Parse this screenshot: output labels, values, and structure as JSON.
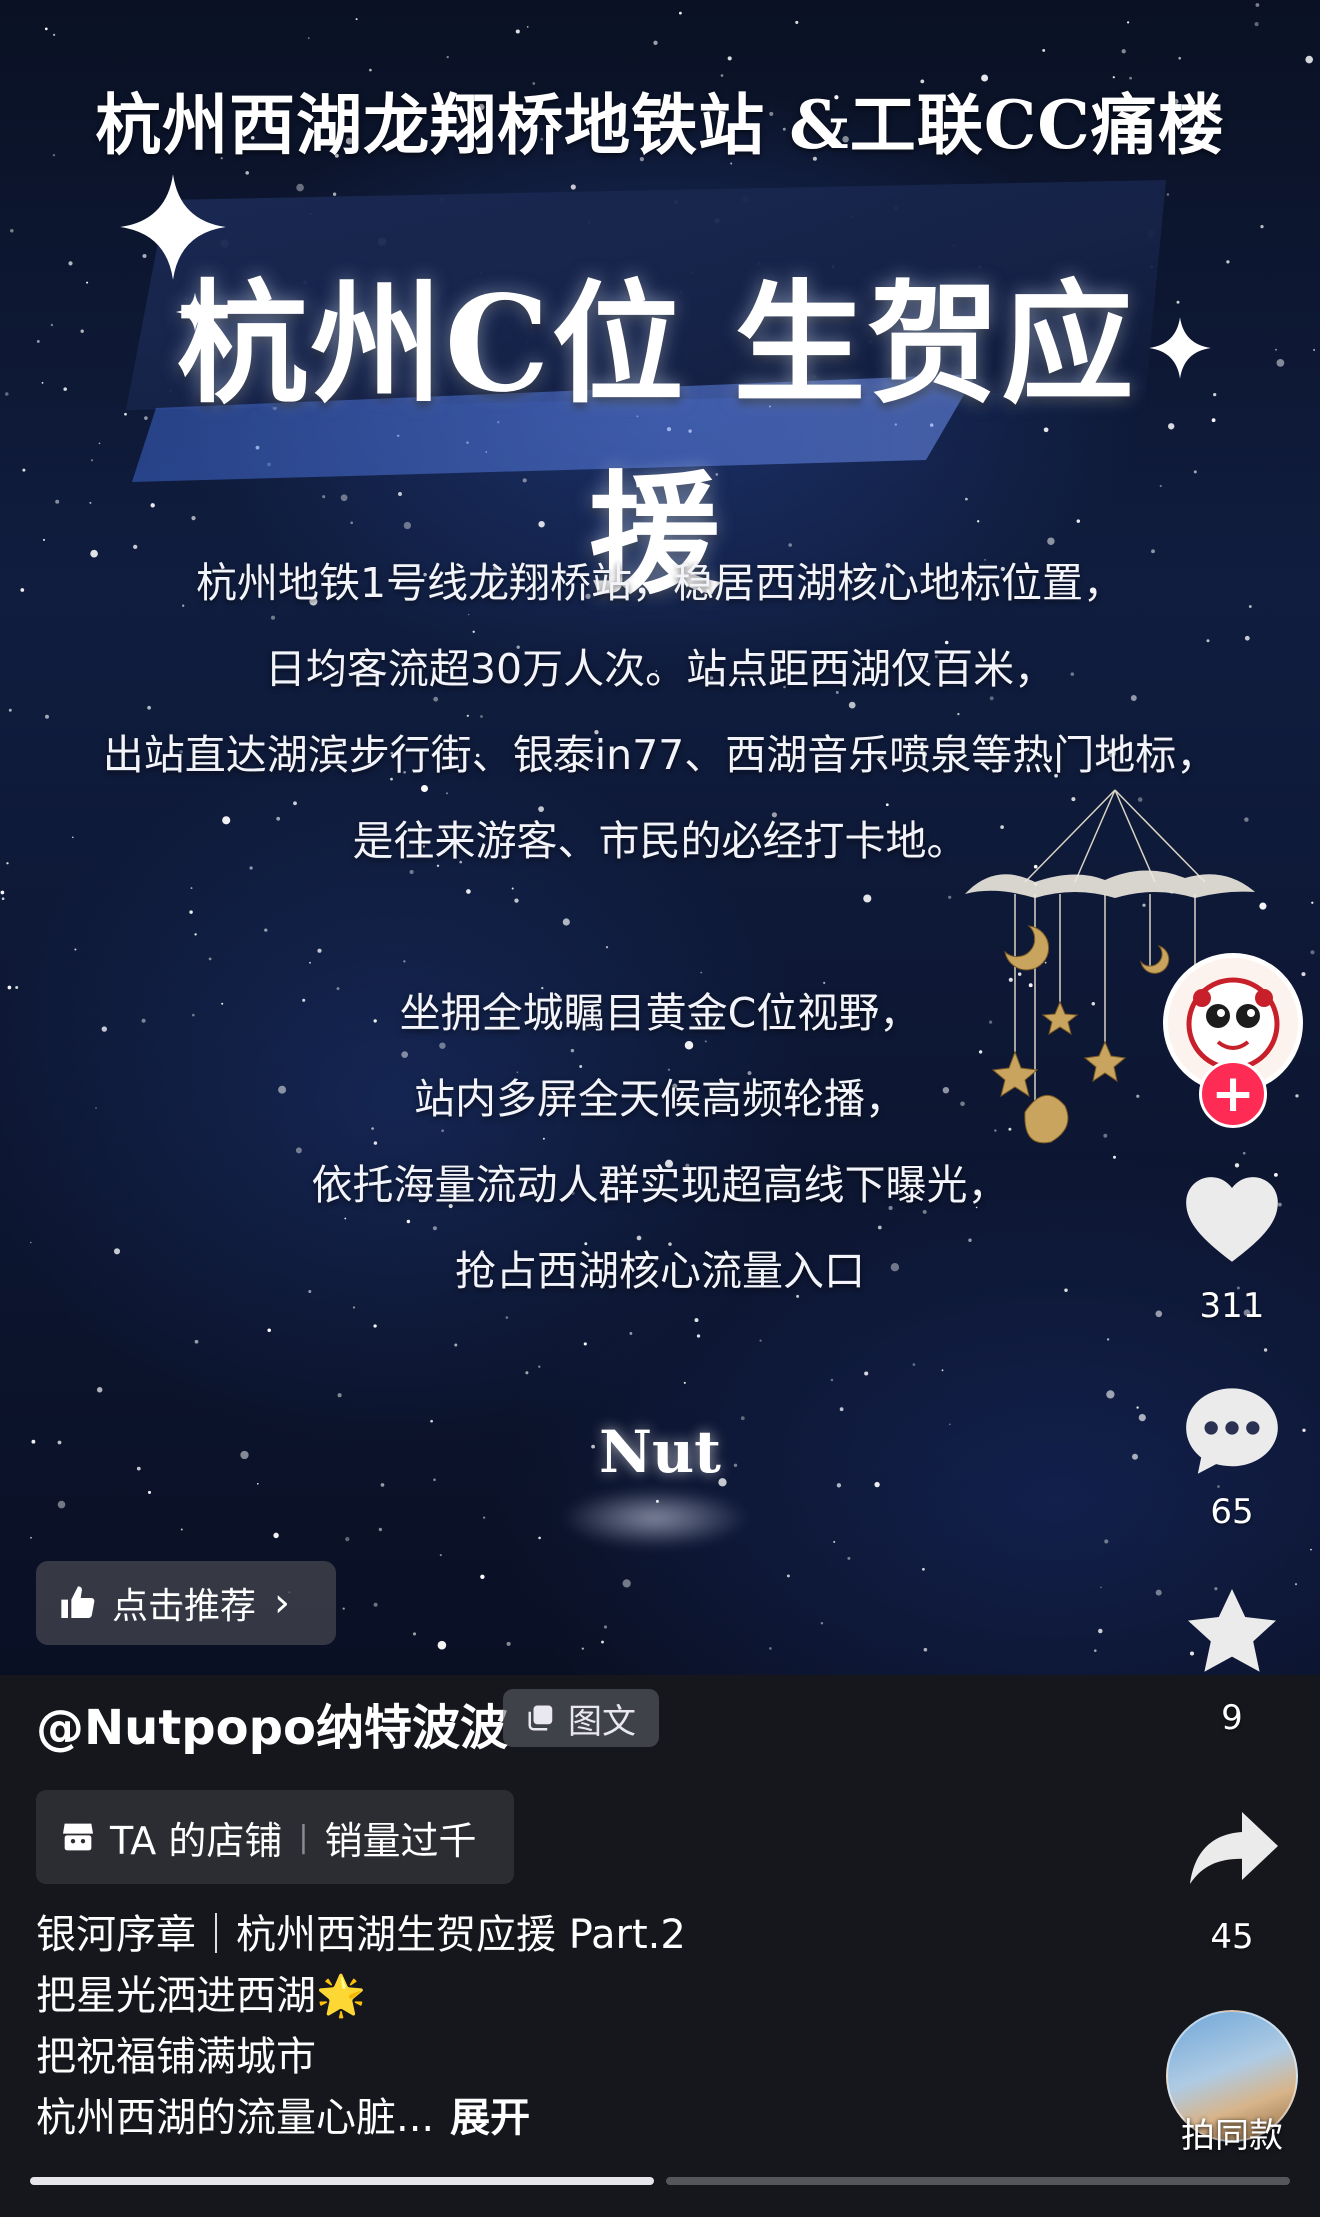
{
  "poster": {
    "headline": "杭州西湖龙翔桥地铁站 &工联CC痛楼",
    "banner_title": "杭州C位 生贺应援",
    "paragraph1": [
      "杭州地铁1号线龙翔桥站，稳居西湖核心地标位置，",
      "日均客流超30万人次。站点距西湖仅百米，",
      "出站直达湖滨步行街、银泰in77、西湖音乐喷泉等热门地标，",
      "是往来游客、市民的必经打卡地。"
    ],
    "paragraph2": [
      "坐拥全城瞩目黄金C位视野，",
      "站内多屏全天候高频轮播，",
      "依托海量流动人群实现超高线下曝光，",
      "抢占西湖核心流量入口"
    ],
    "logo_text": "Nut"
  },
  "recommend": {
    "icon": "thumbs-up-icon",
    "label": "点击推荐"
  },
  "rail": {
    "like_count": "311",
    "comment_count": "65",
    "favorite_count": "9",
    "share_count": "45"
  },
  "info": {
    "author": "@Nutpopo纳特波波",
    "type_badge": "图文",
    "shop_label": "TA 的店铺",
    "shop_sales": "销量过千",
    "description": [
      "银河序章｜杭州西湖生贺应援 Part.2",
      "把星光洒进西湖🌟",
      "把祝福铺满城市",
      "杭州西湖的流量心脏..."
    ],
    "expand_label": "展开",
    "remix_label": "拍同款"
  },
  "progress": {
    "segments": 2,
    "current": 1
  },
  "colors": {
    "follow": "#fe2c55",
    "panel": "#16171d",
    "sky": "#101d3f"
  }
}
